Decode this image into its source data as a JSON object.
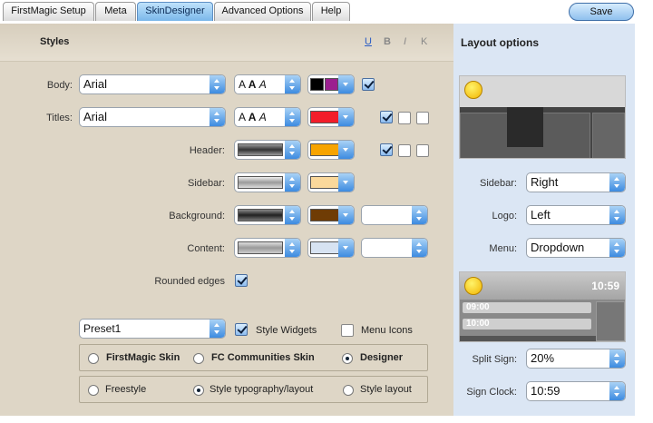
{
  "tabs": [
    {
      "label": "FirstMagic Setup"
    },
    {
      "label": "Meta"
    },
    {
      "label": "SkinDesigner",
      "active": true
    },
    {
      "label": "Advanced Options"
    },
    {
      "label": "Help"
    }
  ],
  "save_label": "Save",
  "styles": {
    "title": "Styles",
    "format_buttons": [
      "U",
      "B",
      "I",
      "K"
    ],
    "rows": {
      "body": {
        "label": "Body:",
        "font": "Arial",
        "font_style": "A",
        "color_fg": "#000000",
        "color_bg": "#9b1f8f"
      },
      "titles": {
        "label": "Titles:",
        "font": "Arial",
        "font_style": "A",
        "color": "#f21d2a"
      },
      "header": {
        "label": "Header:",
        "color": "#f7a400"
      },
      "sidebar": {
        "label": "Sidebar:",
        "color": "#fad89b"
      },
      "background": {
        "label": "Background:",
        "color": "#6f3c05"
      },
      "content": {
        "label": "Content:",
        "color": "#d7e3f2"
      }
    },
    "rounded_edges": "Rounded edges",
    "preset": "Preset1",
    "style_widgets": "Style Widgets",
    "menu_icons": "Menu Icons",
    "skins": [
      "FirstMagic Skin",
      "FC Communities Skin",
      "Designer"
    ],
    "modes": [
      "Freestyle",
      "Style typography/layout",
      "Style layout"
    ]
  },
  "layout": {
    "title": "Layout options",
    "sidebar_label": "Sidebar:",
    "sidebar_value": "Right",
    "logo_label": "Logo:",
    "logo_value": "Left",
    "menu_label": "Menu:",
    "menu_value": "Dropdown",
    "clock_display": "10:59",
    "clock_rows": [
      "09:00",
      "10:00"
    ],
    "split_sign_label": "Split Sign:",
    "split_sign_value": "20%",
    "sign_clock_label": "Sign Clock:",
    "sign_clock_value": "10:59"
  },
  "colors": {
    "accent": "#3d8be0",
    "panel_left": "#ded6c6",
    "panel_right": "#dbe6f4"
  }
}
